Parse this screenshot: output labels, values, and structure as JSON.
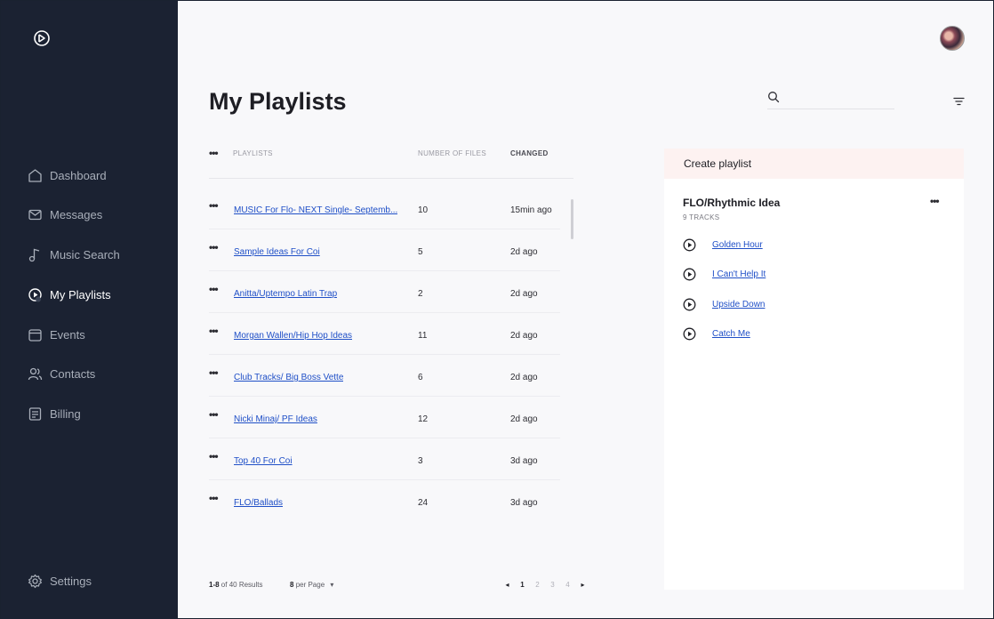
{
  "sidebar": {
    "items": [
      {
        "label": "Dashboard",
        "icon": "home-icon",
        "active": false
      },
      {
        "label": "Messages",
        "icon": "mail-icon",
        "active": false
      },
      {
        "label": "Music Search",
        "icon": "music-note-icon",
        "active": false
      },
      {
        "label": "My Playlists",
        "icon": "play-circle-icon",
        "active": true
      },
      {
        "label": "Events",
        "icon": "calendar-icon",
        "active": false
      },
      {
        "label": "Contacts",
        "icon": "users-icon",
        "active": false
      },
      {
        "label": "Billing",
        "icon": "receipt-icon",
        "active": false
      }
    ],
    "settings_label": "Settings"
  },
  "header": {
    "title": "My Playlists",
    "search_placeholder": ""
  },
  "table": {
    "columns": {
      "playlists": "PLAYLISTS",
      "files": "NUMBER OF FILES",
      "changed": "CHANGED"
    },
    "rows": [
      {
        "name": "MUSIC For Flo- NEXT Single- Septemb...",
        "files": "10",
        "changed": "15min ago"
      },
      {
        "name": "Sample Ideas For Coi",
        "files": "5",
        "changed": "2d ago"
      },
      {
        "name": "Anitta/Uptempo Latin Trap",
        "files": "2",
        "changed": "2d ago"
      },
      {
        "name": "Morgan Wallen/Hip Hop Ideas",
        "files": "11",
        "changed": "2d ago"
      },
      {
        "name": "Club Tracks/ Big Boss Vette",
        "files": "6",
        "changed": "2d ago"
      },
      {
        "name": "Nicki Minaj/ PF Ideas",
        "files": "12",
        "changed": "2d ago"
      },
      {
        "name": "Top 40 For Coi",
        "files": "3",
        "changed": "3d ago"
      },
      {
        "name": "FLO/Ballads",
        "files": "24",
        "changed": "3d ago"
      }
    ]
  },
  "pagination": {
    "range": "1-8",
    "of_text": "of 40 Results",
    "per_page_value": "8",
    "per_page_text": "per Page",
    "prev": "◂",
    "next": "▸",
    "pages": [
      "1",
      "2",
      "3",
      "4"
    ],
    "current_page": "1"
  },
  "panel": {
    "create_label": "Create playlist",
    "playlist_title": "FLO/Rhythmic Idea",
    "track_count": "9 TRACKS",
    "tracks": [
      "Golden Hour",
      "I Can't Help It",
      "Upside Down",
      "Catch Me"
    ]
  },
  "colors": {
    "sidebar_bg": "#1b2232",
    "link": "#1f4fc7",
    "create_bg": "#fdf2f1"
  }
}
